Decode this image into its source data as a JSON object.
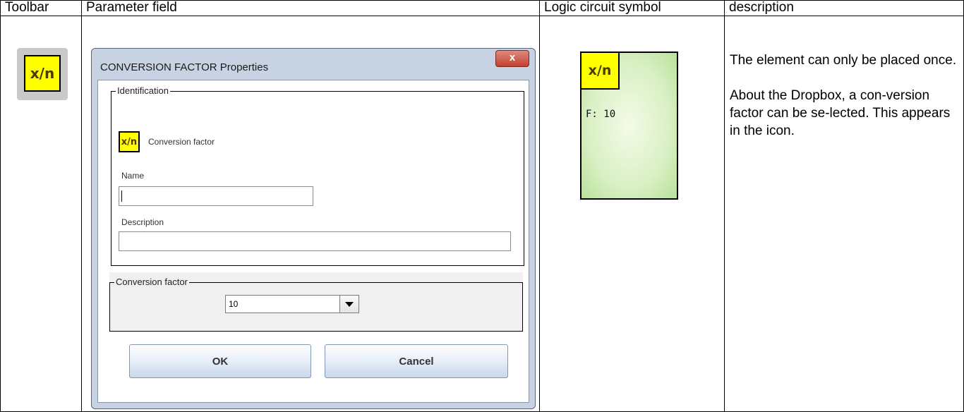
{
  "headers": {
    "toolbar": "Toolbar",
    "parameter_field": "Parameter field",
    "logic_symbol": "Logic circuit symbol",
    "description": "description"
  },
  "toolbar_icon": {
    "label": "x/n",
    "icon": "conversion-factor-icon",
    "color": "#ffff00"
  },
  "dialog": {
    "title": "CONVERSION FACTOR Properties",
    "close_label": "x",
    "identification": {
      "legend": "Identification",
      "icon_label": "x/n",
      "element_name": "Conversion factor"
    },
    "name": {
      "label": "Name",
      "value": ""
    },
    "description": {
      "label": "Description",
      "value": ""
    },
    "conversion_factor": {
      "legend": "Conversion factor",
      "selected": "10"
    },
    "ok_label": "OK",
    "cancel_label": "Cancel"
  },
  "symbol": {
    "label": "x/n",
    "factor_text": "F: 10"
  },
  "desc": {
    "para1": "The element can only be placed once.",
    "para2": "About the Dropbox, a con-version factor can be se-lected. This appears in the icon."
  }
}
